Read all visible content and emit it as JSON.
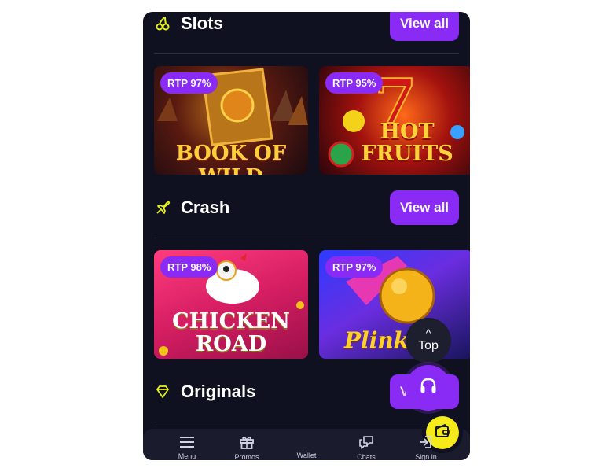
{
  "sections": [
    {
      "title": "Slots",
      "view_all": "View all"
    },
    {
      "title": "Crash",
      "view_all": "View all"
    },
    {
      "title": "Originals",
      "view_all": "View all"
    }
  ],
  "games": [
    {
      "rtp": "RTP 97%",
      "title": "BOOK OF WILD"
    },
    {
      "rtp": "RTP 95%",
      "title": "HOT FRUITS"
    },
    {
      "rtp": "RTP 98%",
      "title": "CHICKEN ROAD"
    },
    {
      "rtp": "RTP 97%",
      "title": "Plinko"
    }
  ],
  "floating": {
    "top_label": "Top",
    "top_arrow": "^"
  },
  "nav": [
    {
      "label": "Menu",
      "icon": "menu-icon"
    },
    {
      "label": "Promos",
      "icon": "gift-icon"
    },
    {
      "label": "Wallet",
      "icon": "wallet-icon"
    },
    {
      "label": "Chats",
      "icon": "chat-icon"
    },
    {
      "label": "Sign in",
      "icon": "sign-in-icon"
    }
  ],
  "colors": {
    "accent": "#8a2bf5",
    "section_icon": "#e6f21a",
    "wallet": "#f5ea1a",
    "background": "#0f1020"
  }
}
